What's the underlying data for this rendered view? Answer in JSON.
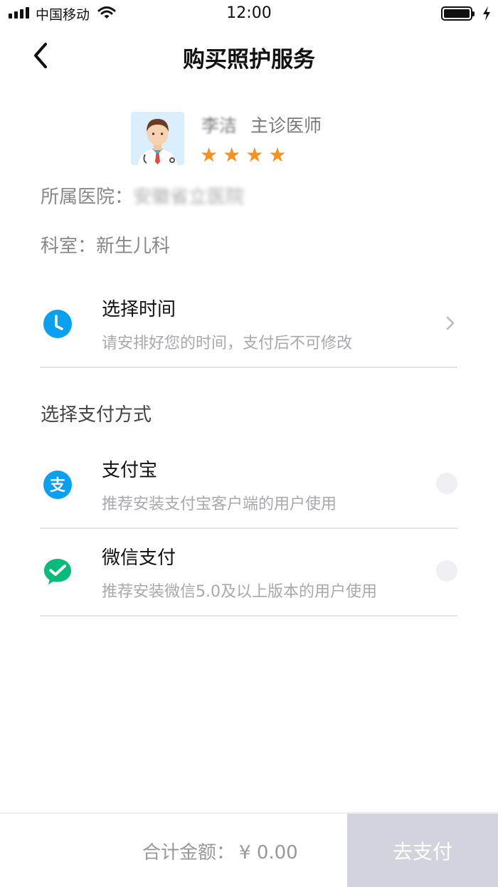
{
  "status_bar": {
    "carrier": "中国移动",
    "time": "12:00"
  },
  "nav": {
    "title": "购买照护服务",
    "back_icon": "chevron-left-icon"
  },
  "doctor": {
    "name": "李洁",
    "title": "主诊医师",
    "rating": 4,
    "rating_max": 4,
    "star_glyph": "★",
    "hospital_label": "所属医院：",
    "hospital_value": "安徽省立医院",
    "department_label": "科室：",
    "department_value": "新生儿科"
  },
  "time_row": {
    "title": "选择时间",
    "subtitle": "请安排好您的时间，支付后不可修改",
    "icon": "clock-icon"
  },
  "payment": {
    "section_title": "选择支付方式",
    "methods": [
      {
        "name": "支付宝",
        "desc": "推荐安装支付宝客户端的用户使用",
        "icon": "alipay-icon",
        "selected": false
      },
      {
        "name": "微信支付",
        "desc": "推荐安装微信5.0及以上版本的用户使用",
        "icon": "wechat-pay-icon",
        "selected": false
      }
    ]
  },
  "footer": {
    "total_label": "合计金额：",
    "total_amount": "¥ 0.00",
    "pay_button": "去支付"
  },
  "colors": {
    "accent_blue": "#0aa0f0",
    "wechat_green": "#09bb7a",
    "star_orange": "#f6901e",
    "pay_button_disabled": "#d3d2df"
  }
}
